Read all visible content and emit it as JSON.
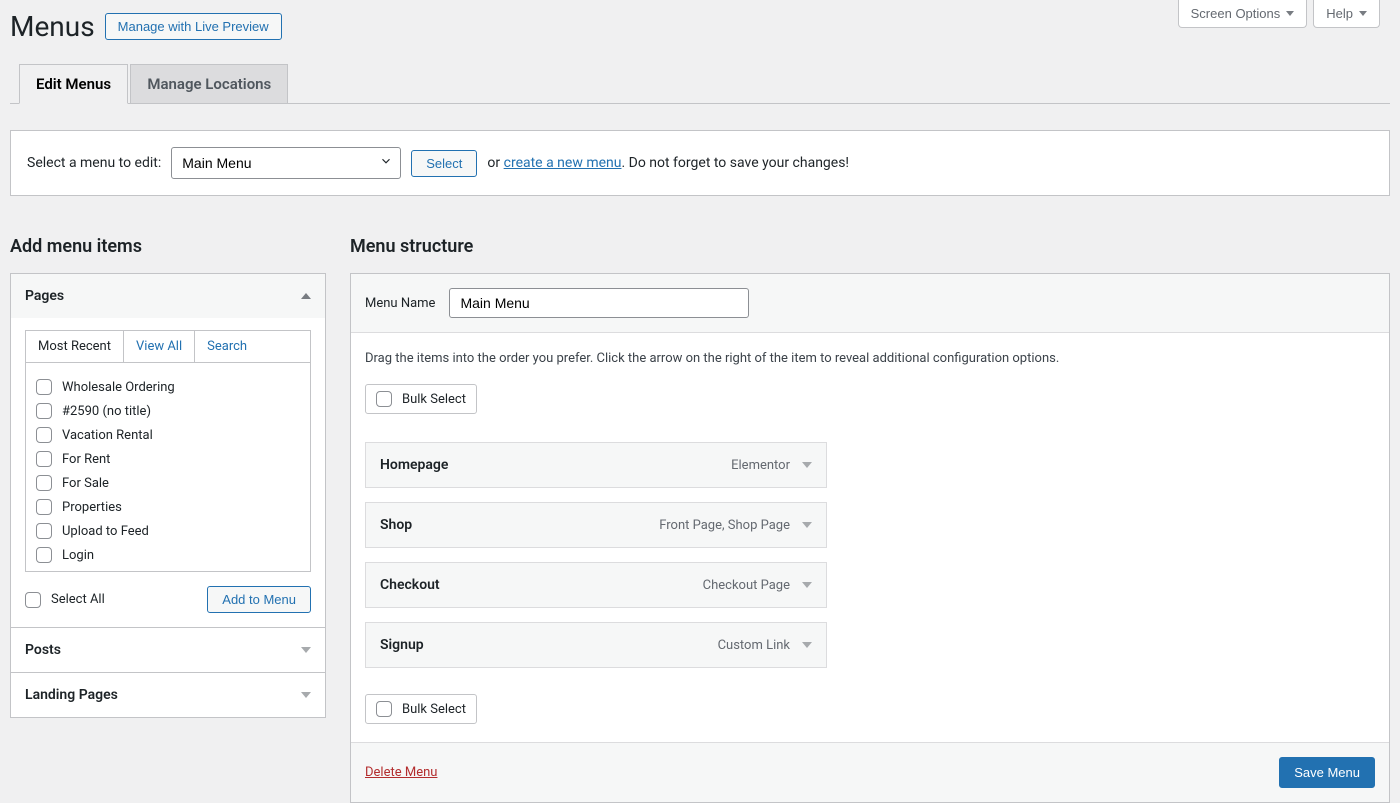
{
  "screen_meta": {
    "screen_options": "Screen Options",
    "help": "Help"
  },
  "page_title": "Menus",
  "live_preview_label": "Manage with Live Preview",
  "tabs": {
    "edit": "Edit Menus",
    "locations": "Manage Locations"
  },
  "select_bar": {
    "label": "Select a menu to edit:",
    "selected": "Main Menu",
    "select_btn": "Select",
    "or": "or",
    "create_link": "create a new menu",
    "reminder": ". Do not forget to save your changes!"
  },
  "left": {
    "heading": "Add menu items",
    "pages_title": "Pages",
    "inner_tabs": {
      "recent": "Most Recent",
      "view_all": "View All",
      "search": "Search"
    },
    "pages": [
      "Wholesale Ordering",
      "#2590 (no title)",
      "Vacation Rental",
      "For Rent",
      "For Sale",
      "Properties",
      "Upload to Feed",
      "Login"
    ],
    "select_all": "Select All",
    "add_to_menu": "Add to Menu",
    "posts_title": "Posts",
    "landing_title": "Landing Pages"
  },
  "right": {
    "heading": "Menu structure",
    "menu_name_label": "Menu Name",
    "menu_name_value": "Main Menu",
    "description": "Drag the items into the order you prefer. Click the arrow on the right of the item to reveal additional configuration options.",
    "bulk_select": "Bulk Select",
    "items": [
      {
        "title": "Homepage",
        "type": "Elementor"
      },
      {
        "title": "Shop",
        "type": "Front Page, Shop Page"
      },
      {
        "title": "Checkout",
        "type": "Checkout Page"
      },
      {
        "title": "Signup",
        "type": "Custom Link"
      }
    ],
    "delete": "Delete Menu",
    "save": "Save Menu"
  }
}
